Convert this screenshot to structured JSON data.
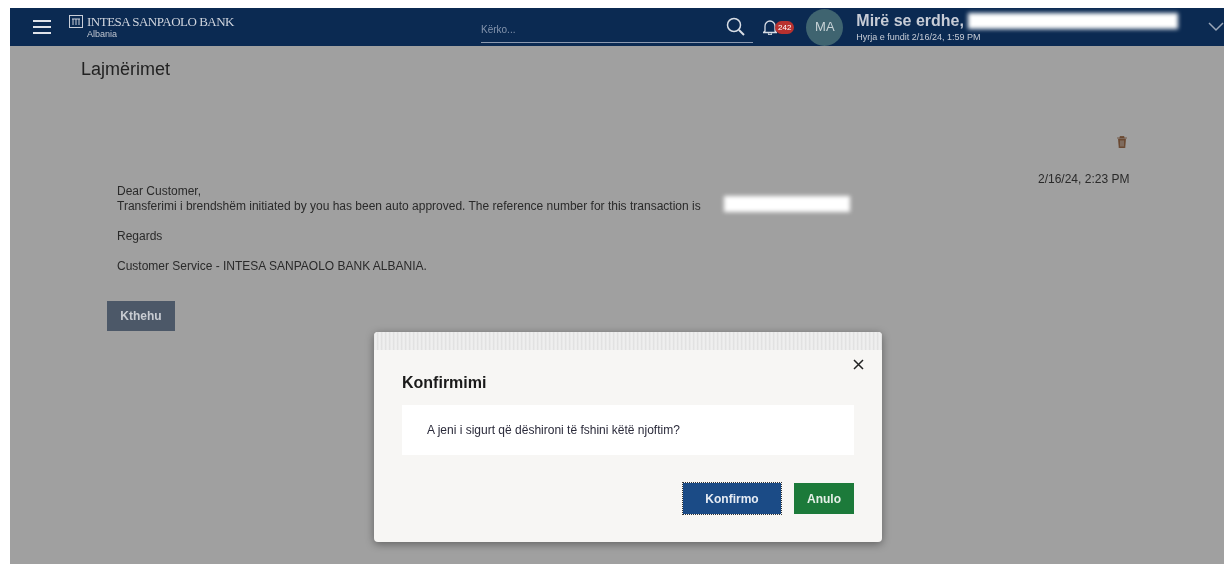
{
  "header": {
    "bank_name": "INTESA SANPAOLO BANK",
    "bank_country": "Albania",
    "search": {
      "placeholder": "Kërko..."
    },
    "notification_count": "242",
    "avatar": "MA",
    "greeting": "Mirë se erdhe,",
    "last_login": "Hyrja e fundit 2/16/24, 1:59 PM"
  },
  "page": {
    "title": "Lajmërimet",
    "date": "2/16/24, 2:23 PM",
    "message": [
      [
        "Dear Customer,",
        "Transferimi i brendshëm initiated by you has been auto approved. The reference number for this transaction is"
      ],
      [
        "Regards"
      ],
      [
        "Customer Service - INTESA SANPAOLO BANK ALBANIA."
      ]
    ],
    "back_button": "Kthehu"
  },
  "dialog": {
    "title": "Konfirmimi",
    "message": "A jeni i sigurt që dëshironi të fshini këtë njoftim?",
    "buttons": [
      {
        "label": "Konfirmo",
        "kind": "primary"
      },
      {
        "label": "Anulo",
        "kind": "secondary"
      }
    ]
  }
}
